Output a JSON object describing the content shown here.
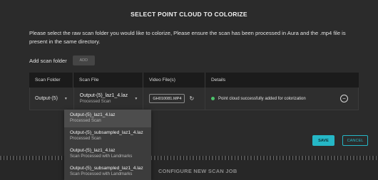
{
  "dialog": {
    "title": "SELECT POINT CLOUD TO COLORIZE",
    "description": "Please select the raw scan folder you would like to colorize, Please ensure the scan has been processed in Aura and the .mp4 file is present in the same directory.",
    "add_scan_label": "Add scan folder",
    "add_button": "ADD"
  },
  "table": {
    "headers": [
      "Scan Folder",
      "Scan File",
      "Video File(s)",
      "Details"
    ],
    "row": {
      "scan_folder": "Output-(5)",
      "scan_file": "Output-(5)_laz1_4.laz",
      "scan_file_type": "Processed Scan",
      "video_file": "GH010081.MP4",
      "details": "Point cloud successfully added for colorization",
      "status_color": "#4cc36b"
    }
  },
  "dropdown": {
    "options": [
      {
        "file": "Output-(5)_laz1_4.laz",
        "type": "Processed Scan"
      },
      {
        "file": "Output-(5)_subsampled_laz1_4.laz",
        "type": "Processed Scan"
      },
      {
        "file": "Output-(5)_laz1_4.laz",
        "type": "Scan Processed with Landmarks"
      },
      {
        "file": "Output-(5)_subsampled_laz1_4.laz",
        "type": "Scan Processed with Landmarks"
      }
    ]
  },
  "actions": {
    "save": "SAVE",
    "cancel": "CANCEL"
  },
  "footer": {
    "configure_label": "CONFIGURE NEW SCAN JOB"
  },
  "colors": {
    "accent": "#25b7c6",
    "background": "#2b2b2b",
    "header_bg": "#1b1b1b"
  },
  "icons": {
    "dropdown": "caret-down-icon",
    "refresh": "refresh-icon",
    "remove": "minus-circle-icon",
    "status": "status-dot-icon"
  }
}
